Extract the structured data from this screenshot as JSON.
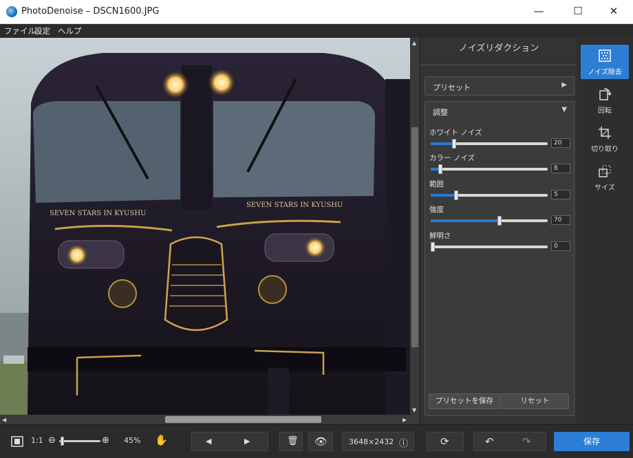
{
  "window": {
    "title": "PhotoDenoise – DSCN1600.JPG",
    "minimize": "—",
    "maximize": "☐",
    "close": "✕"
  },
  "menu": {
    "file": "ファイル",
    "settings": "設定",
    "help": "ヘルプ"
  },
  "photo": {
    "text_left": "SEVEN STARS IN KYUSHU",
    "text_right": "SEVEN STARS IN KYUSHU"
  },
  "panel": {
    "title": "ノイズリダクション",
    "preset_label": "プリセット",
    "adjust_label": "調整",
    "sliders": [
      {
        "label": "ホワイト ノイズ",
        "value": "20",
        "level": 0.2
      },
      {
        "label": "カラー ノイズ",
        "value": "8",
        "level": 0.08
      },
      {
        "label": "範囲",
        "value": "5",
        "level": 0.22
      },
      {
        "label": "強度",
        "value": "70",
        "level": 0.59
      },
      {
        "label": "鮮明さ",
        "value": "0",
        "level": 0.0
      }
    ],
    "save_preset": "プリセットを保存",
    "reset": "リセット"
  },
  "tools": [
    {
      "label": "ノイズ除去",
      "icon": "noise-icon",
      "active": true
    },
    {
      "label": "回転",
      "icon": "rotate-icon",
      "active": false
    },
    {
      "label": "切り取り",
      "icon": "crop-icon",
      "active": false
    },
    {
      "label": "サイズ",
      "icon": "resize-icon",
      "active": false
    }
  ],
  "bottom": {
    "ratio": "1:1",
    "zoom": "45%",
    "dimensions": "3648×2432",
    "save": "保存"
  },
  "colors": {
    "accent": "#2d7fd6",
    "dark": "#2b2b2b"
  }
}
